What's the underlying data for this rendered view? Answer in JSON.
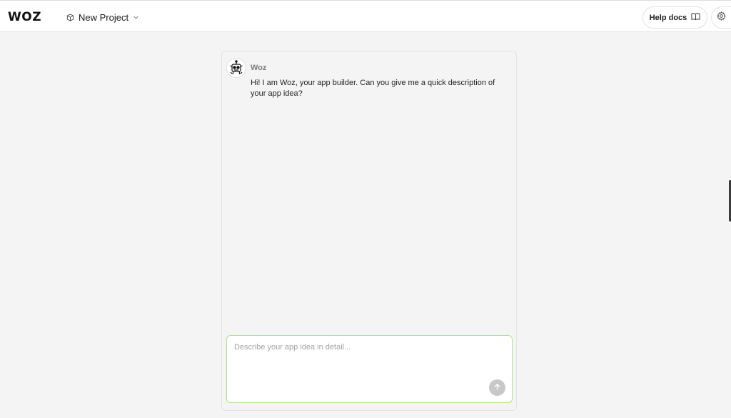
{
  "header": {
    "logo_text": "WOZ",
    "project": {
      "name": "New Project",
      "icon": "cube-icon",
      "dropdown_icon": "chevron-down-icon"
    },
    "help_button": {
      "label": "Help docs",
      "icon": "book-icon"
    },
    "settings_icon": "gear-icon"
  },
  "chat": {
    "messages": [
      {
        "sender": "Woz",
        "avatar_icon": "robot-avatar-icon",
        "text": "Hi! I am Woz, your app builder. Can you give me a quick description of your app idea?"
      }
    ],
    "composer": {
      "value": "",
      "placeholder": "Describe your app idea in detail...",
      "send_icon": "arrow-up-icon"
    }
  },
  "colors": {
    "background": "#f4f4f4",
    "topbar": "#ffffff",
    "composer_border": "#a9e58e",
    "send_button": "#c8c8c8"
  }
}
